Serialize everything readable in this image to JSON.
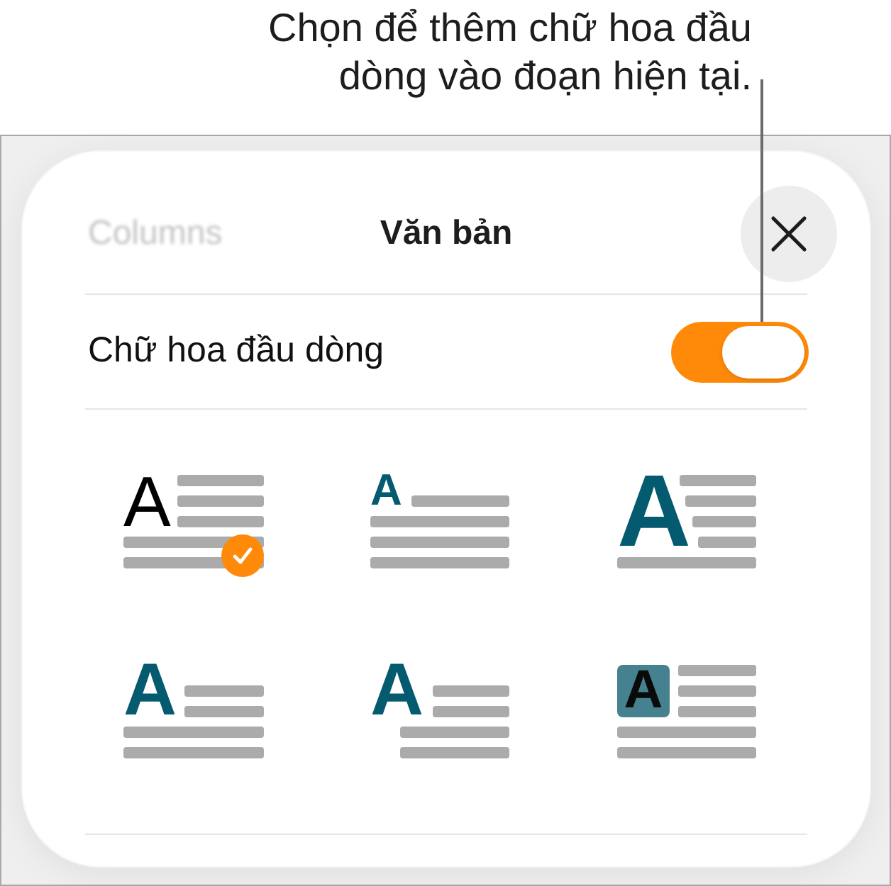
{
  "callout": {
    "lines": [
      "Chọn để thêm chữ hoa đầu",
      "dòng vào đoạn hiện tại."
    ]
  },
  "panel": {
    "back_label": "Columns",
    "title": "Văn bản"
  },
  "drop_cap": {
    "label": "Chữ hoa đầu dòng",
    "on": true
  },
  "styles": [
    {
      "kind": "plain",
      "letter": "A",
      "selected": true
    },
    {
      "kind": "raised",
      "letter": "A",
      "selected": false
    },
    {
      "kind": "large",
      "letter": "A",
      "selected": false
    },
    {
      "kind": "drop",
      "letter": "A",
      "selected": false
    },
    {
      "kind": "margin",
      "letter": "A",
      "selected": false
    },
    {
      "kind": "boxed",
      "letter": "A",
      "selected": false
    }
  ]
}
